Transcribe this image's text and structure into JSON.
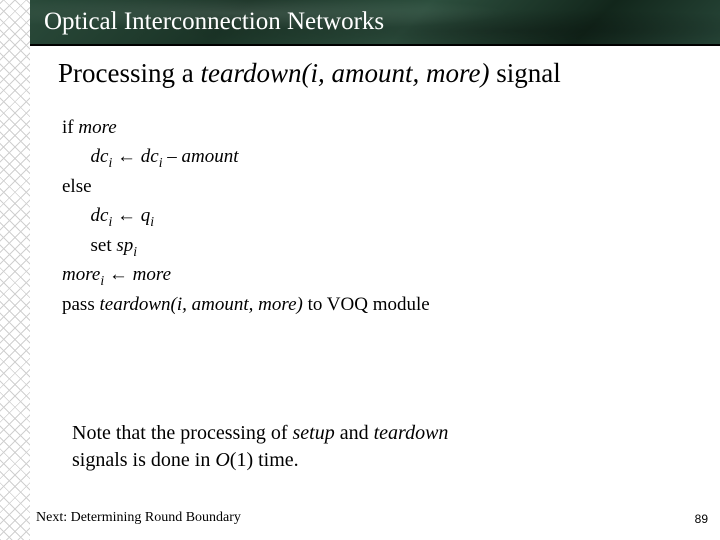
{
  "titleBar": {
    "text": "Optical Interconnection Networks"
  },
  "heading": {
    "prefix": "Processing a ",
    "signal": "teardown(i, amount, more)",
    "suffix": " signal"
  },
  "algo": {
    "if": "if",
    "more": "more",
    "dc": "dc",
    "i": "i",
    "arrow": "←",
    "minus": "–",
    "amount": "amount",
    "else": "else",
    "q": "q",
    "set": "set",
    "sp": "sp",
    "moreVar": "more",
    "pass": "pass",
    "teardownCall": "teardown(i, amount, more)",
    "toVOQ": " to VOQ module"
  },
  "note": {
    "l1a": "Note that the processing of ",
    "setup": "setup",
    "l1b": " and ",
    "teardown": "teardown",
    "l2a": "signals is done in ",
    "o1": "O",
    "paren": "(1)",
    "l2b": " time."
  },
  "footer": {
    "next": "Next: Determining Round Boundary",
    "page": "89"
  }
}
